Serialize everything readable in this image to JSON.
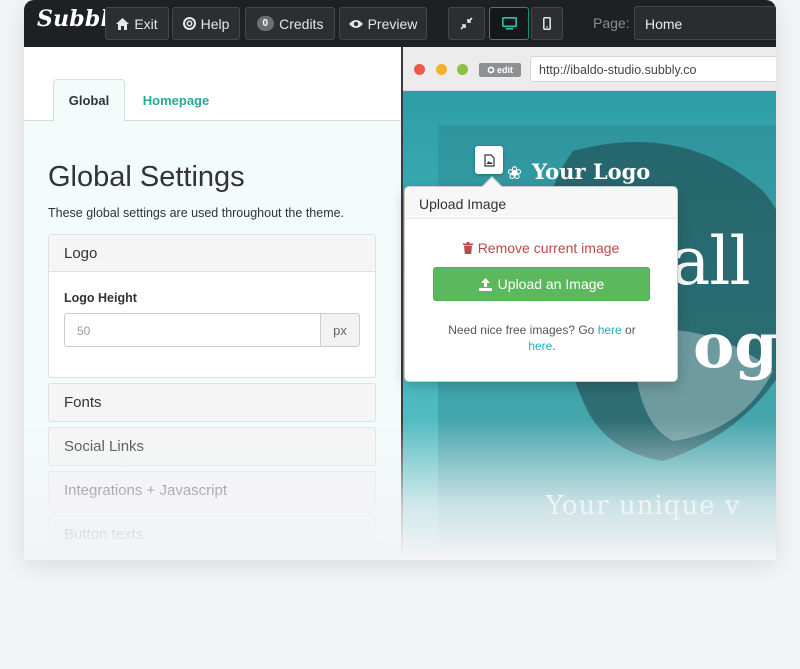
{
  "toolbar": {
    "brand": "Subbly",
    "exit_label": "Exit",
    "help_label": "Help",
    "credits_count": "0",
    "credits_label": "Credits",
    "preview_label": "Preview",
    "page_label": "Page:",
    "page_value": "Home"
  },
  "tabs": {
    "global": "Global",
    "homepage": "Homepage"
  },
  "settings": {
    "title": "Global Settings",
    "description": "These global settings are used throughout the theme.",
    "logo_panel": "Logo",
    "logo_height_label": "Logo Height",
    "logo_height_value": "50",
    "logo_height_unit": "px",
    "fonts_panel": "Fonts",
    "social_panel": "Social Links",
    "integrations_panel": "Integrations + Javascript",
    "button_panel": "Button texts"
  },
  "browser": {
    "edit_badge": "edit",
    "url": "http://ibaldo-studio.subbly.co"
  },
  "site": {
    "logo_text": "Your Logo",
    "hero_line1": "all",
    "hero_line2": "og",
    "tagline": "Your unique v"
  },
  "popover": {
    "title": "Upload Image",
    "remove_label": "Remove current image",
    "upload_label": "Upload an Image",
    "help_prefix": "Need nice free images? Go ",
    "link1": "here",
    "help_or": " or",
    "link2": "here",
    "help_suffix": "."
  },
  "colors": {
    "accent": "#2aa892",
    "toolbar_bg": "#1f2023",
    "success": "#5cb85c",
    "danger": "#b94a48"
  }
}
